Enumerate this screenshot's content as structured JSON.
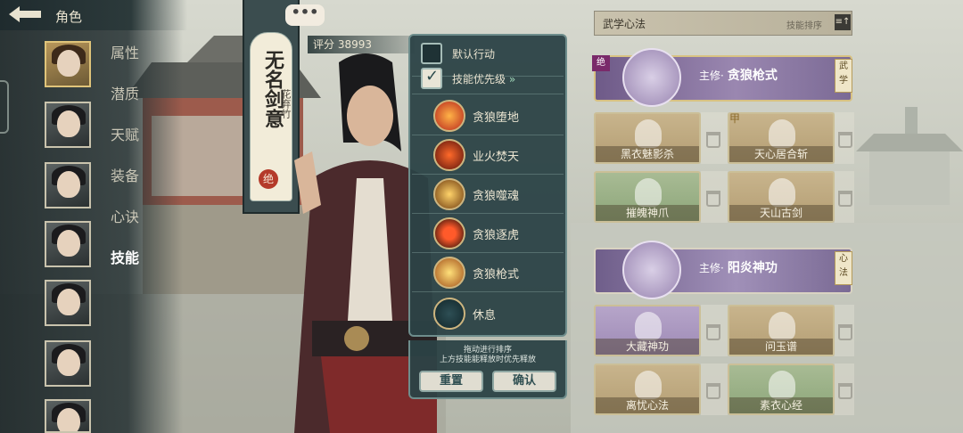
{
  "header": {
    "title": "角色",
    "back_icon": "back-arrow-icon"
  },
  "side_menu": [
    "属性",
    "潜质",
    "天赋",
    "装备",
    "心诀",
    "技能"
  ],
  "active_menu": "技能",
  "character": {
    "name_banner": "无名剑意",
    "banner_sub": "花弃竹",
    "banner_seal": "绝",
    "chat_icon": "•••",
    "score_label": "评分",
    "score_value": "38993"
  },
  "popup": {
    "default_action_label": "默认行动",
    "default_action_checked": false,
    "priority_label": "技能优先级",
    "priority_checked": true,
    "priority_arrow": "»",
    "skills": [
      "贪狼堕地",
      "业火焚天",
      "贪狼噬魂",
      "贪狼逐虎",
      "贪狼枪式",
      "休息"
    ],
    "hint_line1": "拖动进行排序",
    "hint_line2": "上方技能能释放时优先释放",
    "reset_label": "重置",
    "confirm_label": "确认"
  },
  "right_panel": {
    "title": "武学心法",
    "sort_label": "技能排序",
    "sort_icon": "≡↑",
    "main_martial": {
      "prefix": "主修·",
      "name": "贪狼枪式",
      "tag": "武学",
      "corner": "绝"
    },
    "martial_cards": [
      {
        "name": "黑衣魅影杀",
        "color": "tan"
      },
      {
        "name": "天心居合斩",
        "color": "tan"
      },
      {
        "name": "摧魄神爪",
        "color": "green"
      },
      {
        "name": "天山古剑",
        "color": "tan"
      }
    ],
    "main_heart": {
      "prefix": "主修·",
      "name": "阳炎神功",
      "tag": "心法"
    },
    "heart_cards": [
      {
        "name": "大藏神功",
        "color": "purple"
      },
      {
        "name": "问玉谱",
        "color": "tan"
      },
      {
        "name": "离忧心法",
        "color": "tan"
      },
      {
        "name": "素衣心经",
        "color": "green"
      }
    ],
    "card_corner": "甲"
  }
}
